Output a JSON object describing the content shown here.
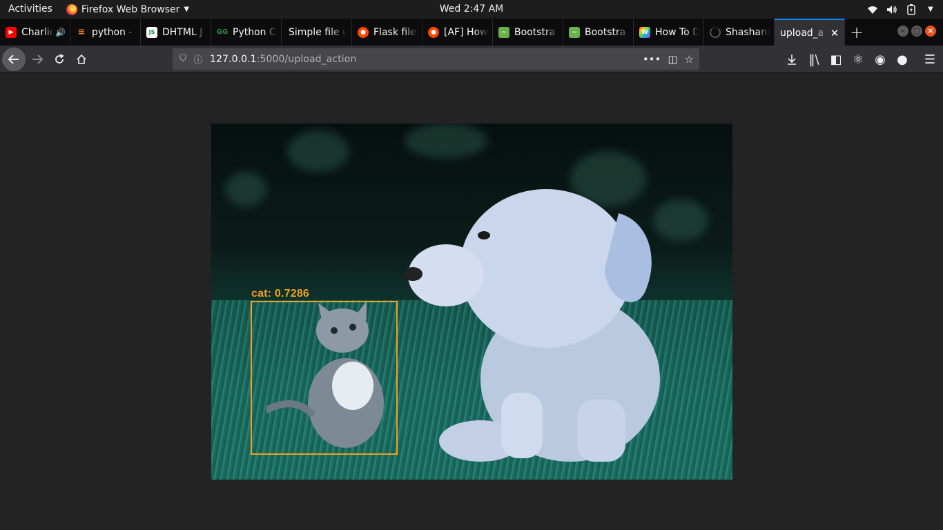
{
  "topbar": {
    "activities": "Activities",
    "app_name": "Firefox Web Browser",
    "clock": "Wed  2:47 AM",
    "tray": {
      "wifi_icon": "wifi-icon",
      "volume_icon": "volume-icon",
      "battery_icon": "battery-icon",
      "menu_icon": "chevron-down-icon"
    }
  },
  "tabs": [
    {
      "title": "Charlie",
      "favicon": "youtube-icon",
      "color": "#ff0000",
      "audio": true
    },
    {
      "title": "python - ",
      "favicon": "stackoverflow-icon",
      "color": "#f48024"
    },
    {
      "title": "DHTML J",
      "favicon": "dhtml-icon",
      "color": "#1b8a3a"
    },
    {
      "title": "Python C",
      "favicon": "geeksforgeeks-icon",
      "color": "#2f8d46"
    },
    {
      "title": "Simple file u",
      "favicon": "",
      "color": ""
    },
    {
      "title": "Flask file",
      "favicon": "reddit-icon",
      "color": "#ff4500"
    },
    {
      "title": "[AF] How",
      "favicon": "reddit-icon",
      "color": "#ff4500"
    },
    {
      "title": "Bootstra",
      "favicon": "bootstrap-icon",
      "color": "#6ab04c"
    },
    {
      "title": "Bootstra",
      "favicon": "bootstrap-icon",
      "color": "#6ab04c"
    },
    {
      "title": "How To D",
      "favicon": "colorful-w-icon",
      "color": "#c23bd4"
    },
    {
      "title": "Shashank",
      "favicon": "loading-icon",
      "color": ""
    },
    {
      "title": "upload_a",
      "favicon": "",
      "color": "",
      "active": true
    }
  ],
  "navbar": {
    "url_host": "127.0.0.1",
    "url_path": ":5000/upload_action"
  },
  "detection": {
    "label": "cat: 0.7286",
    "box_color": "#f0a020"
  }
}
